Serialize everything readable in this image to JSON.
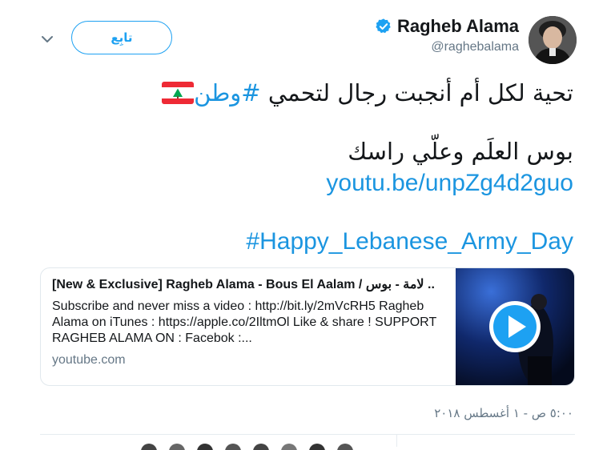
{
  "header": {
    "follow_label": "تابِع",
    "display_name": "Ragheb Alama",
    "handle": "@raghebalama"
  },
  "tweet": {
    "line1_text": "تحية لكل أم أنجبت رجال لتحمي ",
    "line1_hashtag": "#وطن",
    "line2_text": "بوس العلَم وعلّي راسك",
    "link_text": "youtu.be/unpZg4d2guo",
    "army_hashtag": "#Happy_Lebanese_Army_Day"
  },
  "card": {
    "title": "[New & Exclusive] Ragheb Alama - Bous El Aalam / لامة - بوس ..",
    "description": "Subscribe and never miss a video : http://bit.ly/2mVcRH5 Ragheb Alama on iTunes : https://apple.co/2IltmOl Like & share ! SUPPORT RAGHEB ALAMA ON : Facebok :...",
    "domain": "youtube.com"
  },
  "timestamp": "٥:٠٠ ص - ١ أغسطس ٢٠١٨",
  "icons": {
    "chevron": "chevron-down-icon",
    "verified": "verified-badge-icon",
    "flag": "lebanon-flag-icon",
    "play": "play-icon"
  },
  "colors": {
    "accent": "#1da1f2",
    "link": "#1b95e0",
    "secondary_text": "#657786",
    "border": "#e1e8ed"
  }
}
